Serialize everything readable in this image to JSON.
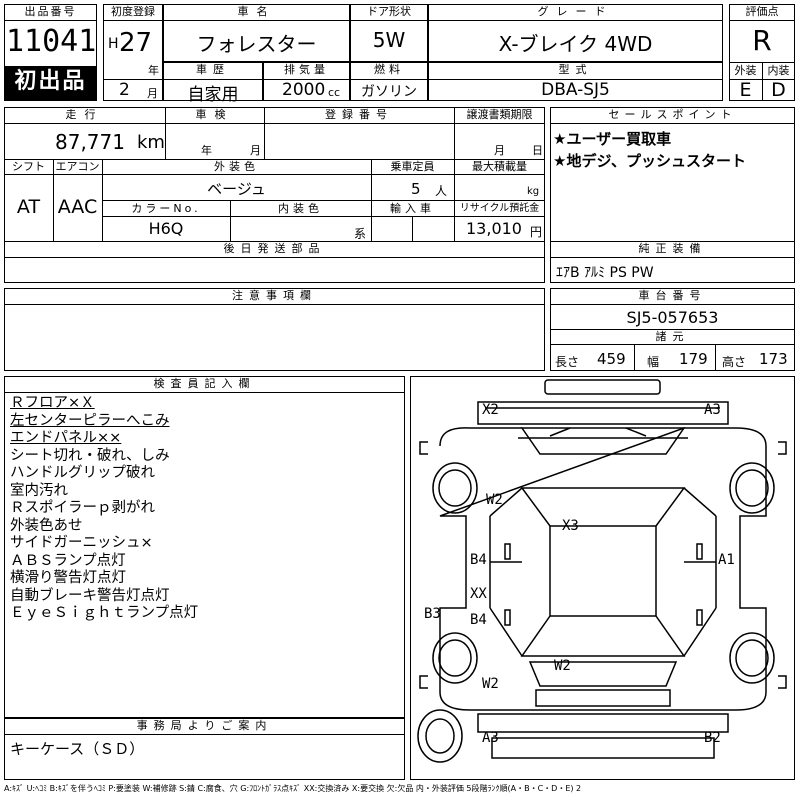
{
  "header": {
    "lot_no_label": "出品番号",
    "lot_no": "11041",
    "first_listing": "初出品",
    "first_reg_label": "初度登録",
    "era": "H",
    "year": "27",
    "year_unit": "年",
    "month": "2",
    "month_unit": "月",
    "car_name_label": "車名",
    "car_name": "フォレスター",
    "door_label": "ドア形状",
    "door": "5W",
    "grade_label": "グレード",
    "grade": "X-ブレイク 4WD",
    "score_label": "評価点",
    "score": "R",
    "history_label": "車歴",
    "history": "自家用",
    "displacement_label": "排気量",
    "displacement": "2000",
    "displacement_unit": "cc",
    "fuel_label": "燃料",
    "fuel": "ガソリン",
    "model_label": "型式",
    "model": "DBA-SJ5",
    "exterior_label": "外装",
    "exterior_grade": "E",
    "interior_label": "内装",
    "interior_grade": "D"
  },
  "row2": {
    "mileage_label": "走行",
    "mileage": "87,771",
    "mileage_unit": "km",
    "inspection_label": "車検",
    "insp_year_unit": "年",
    "insp_month_unit": "月",
    "reg_no_label": "登録番号",
    "transfer_label": "譲渡書類期限",
    "transfer_month_unit": "月",
    "transfer_day_unit": "日",
    "selling_label": "セールスポイント",
    "selling_points": [
      "★ユーザー買取車",
      "★地デジ、プッシュスタート"
    ],
    "shift_label": "シフト",
    "shift": "AT",
    "ac_label": "エアコン",
    "ac": "AAC",
    "color_label": "外装色",
    "color": "ベージュ",
    "capacity_label": "乗車定員",
    "capacity": "5",
    "capacity_unit": "人",
    "load_label": "最大積載量",
    "load_unit": "kg",
    "color_no_label": "カラーNo.",
    "color_no": "H6Q",
    "int_color_label": "内装色",
    "int_color_unit": "系",
    "import_label": "輸入車",
    "recycle_label": "リサイクル預託金",
    "recycle": "13,010",
    "recycle_unit": "円",
    "later_parts_label": "後日発送部品",
    "equipment_label": "純正装備",
    "equipment": "ｴｱB ｱﾙﾐ PS PW"
  },
  "notes": {
    "caution_label": "注意事項欄",
    "chassis_label": "車台番号",
    "chassis": "SJ5-057653",
    "dims_label": "諸元",
    "length_label": "長さ",
    "length": "459",
    "width_label": "幅",
    "width": "179",
    "height_label": "高さ",
    "height": "173"
  },
  "inspector": {
    "label": "検査員記入欄",
    "lines": [
      "Ｒフロア×Ｘ",
      "左センターピラーへこみ",
      "エンドパネル××",
      "シート切れ・破れ、しみ",
      "ハンドルグリップ破れ",
      "室内汚れ",
      "Ｒスポイラーｐ剥がれ",
      "外装色あせ",
      "サイドガーニッシュ×",
      "ＡＢＳランプ点灯",
      "横滑り警告灯点灯",
      "自動ブレーキ警告灯点灯",
      "ＥｙｅＳｉｇｈｔランプ点灯"
    ]
  },
  "diagram": {
    "labels": {
      "x2": "X2",
      "a3_top": "A3",
      "w2_front": "W2",
      "x3": "X3",
      "b4_upper": "B4",
      "a1": "A1",
      "xx": "XX",
      "b4_lower": "B4",
      "b3": "B3",
      "w2_rear": "W2",
      "w2_left_rear": "W2",
      "a3_bottom": "A3",
      "b2": "B2"
    }
  },
  "office": {
    "label": "事務局よりご案内",
    "text": "キーケース（ＳＤ）"
  },
  "footer": {
    "legend": "A:ｷｽﾞ U:ﾍｺﾐ B:ｷｽﾞを伴うﾍｺﾐ P:要塗装 W:補修跡 S:錆 C:腐食、穴 G:ﾌﾛﾝﾄｶﾞﾗｽ点ｷｽﾞ XX:交換済み X:要交換 欠:欠品 内・外装評価 5段階ﾗﾝｸ順(A・B・C・D・E) 2"
  }
}
